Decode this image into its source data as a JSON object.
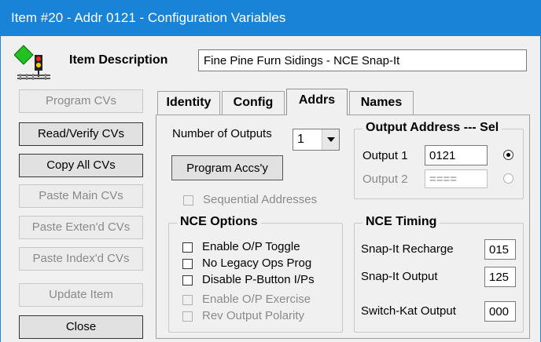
{
  "window": {
    "title": "Item #20 - Addr 0121 - Configuration Variables"
  },
  "item": {
    "description_label": "Item Description",
    "description_value": "Fine Pine Furn Sidings - NCE Snap-It"
  },
  "sidebar": {
    "program_cvs": "Program CVs",
    "read_verify_cvs": "Read/Verify CVs",
    "copy_all_cvs": "Copy All CVs",
    "paste_main_cvs": "Paste Main CVs",
    "paste_extend_cvs": "Paste Exten'd CVs",
    "paste_index_cvs": "Paste Index'd CVs",
    "update_item": "Update Item",
    "close": "Close"
  },
  "tabs": {
    "identity": "Identity",
    "config": "Config",
    "addrs": "Addrs",
    "names": "Names"
  },
  "addrs": {
    "number_of_outputs_label": "Number of Outputs",
    "number_of_outputs_value": "1",
    "program_accsy": "Program Accs'y",
    "sequential_addresses": "Sequential Addresses",
    "output_address_legend": "Output Address --- Sel",
    "output1_label": "Output 1",
    "output1_value": "0121",
    "output2_label": "Output 2",
    "output2_value": "===="
  },
  "nce_options": {
    "legend": "NCE Options",
    "enable_op_toggle": "Enable O/P Toggle",
    "no_legacy_ops_prog": "No Legacy Ops Prog",
    "disable_pbutton": "Disable P-Button I/Ps",
    "enable_op_exercise": "Enable O/P Exercise",
    "rev_output_polarity": "Rev Output Polarity"
  },
  "nce_timing": {
    "legend": "NCE Timing",
    "snapit_recharge_label": "Snap-It Recharge",
    "snapit_recharge_value": "015",
    "snapit_output_label": "Snap-It Output",
    "snapit_output_value": "125",
    "switchkat_output_label": "Switch-Kat Output",
    "switchkat_output_value": "000"
  }
}
